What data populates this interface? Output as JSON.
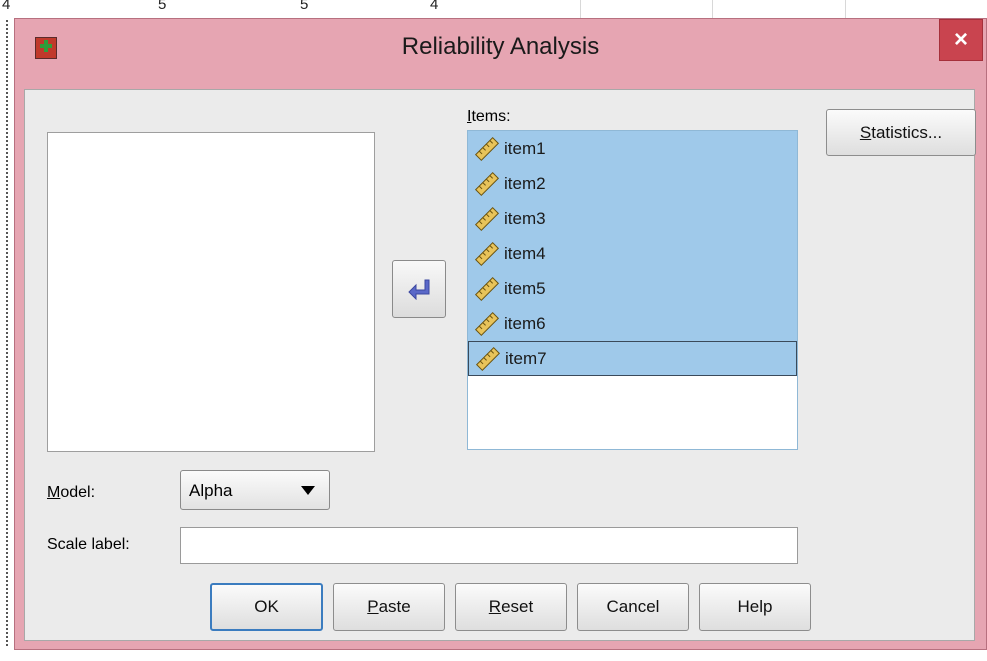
{
  "background": {
    "ruler_ticks": [
      "4",
      "5",
      "5",
      "4"
    ]
  },
  "dialog": {
    "title": "Reliability Analysis",
    "close_label": "×"
  },
  "items_label": {
    "mnemonic": "I",
    "rest": "tems:"
  },
  "items": [
    {
      "label": "item1",
      "icon": "scale-ruler-icon"
    },
    {
      "label": "item2",
      "icon": "scale-ruler-icon"
    },
    {
      "label": "item3",
      "icon": "scale-ruler-icon"
    },
    {
      "label": "item4",
      "icon": "scale-ruler-icon"
    },
    {
      "label": "item5",
      "icon": "scale-ruler-icon"
    },
    {
      "label": "item6",
      "icon": "scale-ruler-icon"
    },
    {
      "label": "item7",
      "icon": "scale-ruler-icon"
    }
  ],
  "statistics_button": {
    "mnemonic": "S",
    "rest": "tatistics..."
  },
  "model": {
    "label_mnemonic": "M",
    "label_rest": "odel:",
    "selected": "Alpha"
  },
  "scale_label": {
    "label": "Scale label:",
    "value": ""
  },
  "buttons": {
    "ok": "OK",
    "paste_mnemonic": "P",
    "paste_rest": "aste",
    "reset_mnemonic": "R",
    "reset_rest": "eset",
    "cancel": "Cancel",
    "help": "Help"
  },
  "colors": {
    "title_bar": "#e6a5b2",
    "close_button": "#c9444f",
    "selection": "#9fc9ea",
    "dialog_body": "#ebebeb"
  }
}
